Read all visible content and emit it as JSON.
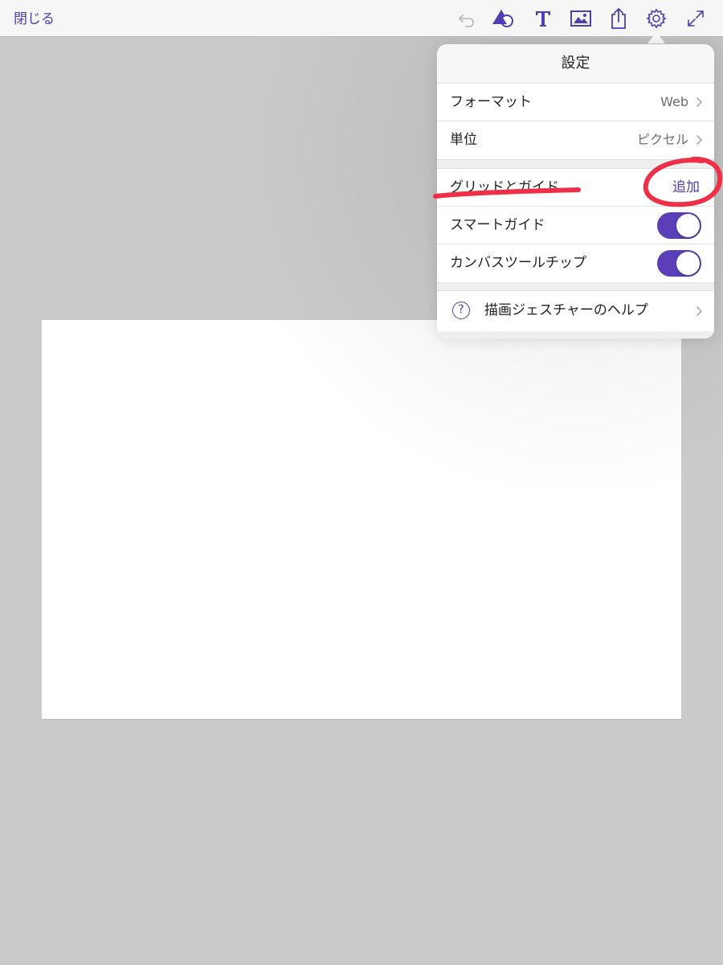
{
  "toolbar": {
    "close_label": "閉じる",
    "icons": [
      "undo-icon",
      "shapes-icon",
      "text-icon",
      "image-icon",
      "share-icon",
      "gear-icon",
      "expand-icon"
    ],
    "accent_color": "#4f3fb0"
  },
  "settings": {
    "title": "設定",
    "format": {
      "label": "フォーマット",
      "value": "Web"
    },
    "units": {
      "label": "単位",
      "value": "ピクセル"
    },
    "grids_guides": {
      "label": "グリッドとガイド",
      "action": "追加"
    },
    "smart_guides": {
      "label": "スマートガイド",
      "on": true
    },
    "canvas_tooltips": {
      "label": "カンバスツールチップ",
      "on": true
    },
    "help": {
      "icon": "?",
      "label": "描画ジェスチャーのヘルプ"
    }
  },
  "annotation_color": "#ee2f45"
}
